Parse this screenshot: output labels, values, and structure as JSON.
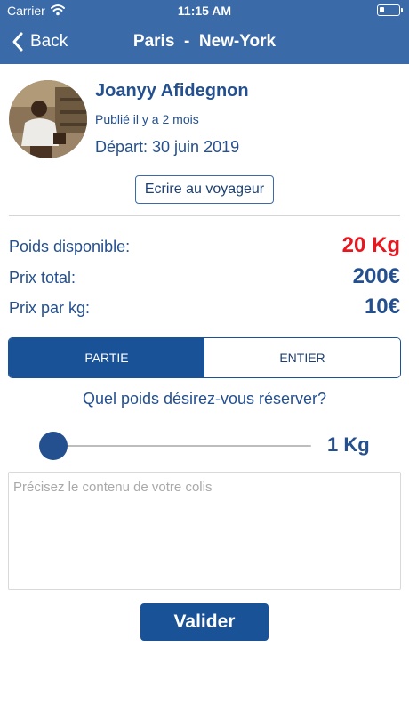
{
  "status_bar": {
    "carrier": "Carrier",
    "time": "11:15 AM"
  },
  "nav": {
    "back_label": "Back",
    "title": "Paris  -  New-York"
  },
  "traveler": {
    "name": "Joanyy Afidegnon",
    "published": "Publié il y a 2 mois",
    "departure": "Départ: 30 juin 2019",
    "contact_label": "Ecrire au voyageur"
  },
  "details": {
    "weight_label": "Poids disponible:",
    "weight_value": "20 Kg",
    "total_label": "Prix total:",
    "total_value": "200€",
    "per_kg_label": "Prix par kg:",
    "per_kg_value": "10€"
  },
  "booking_mode": {
    "options": [
      "PARTIE",
      "ENTIER"
    ],
    "selected": "PARTIE"
  },
  "weight_selector": {
    "question": "Quel poids désirez-vous réserver?",
    "value_label": "1 Kg",
    "value_kg": 1
  },
  "parcel": {
    "placeholder": "Précisez le contenu de votre colis",
    "value": ""
  },
  "submit_label": "Valider",
  "colors": {
    "header": "#3b6aa8",
    "primary": "#1a5298",
    "text": "#24508f",
    "alert": "#e8171f"
  },
  "icons": {
    "back": "chevron-left-icon",
    "wifi": "wifi-icon",
    "battery": "battery-icon"
  }
}
